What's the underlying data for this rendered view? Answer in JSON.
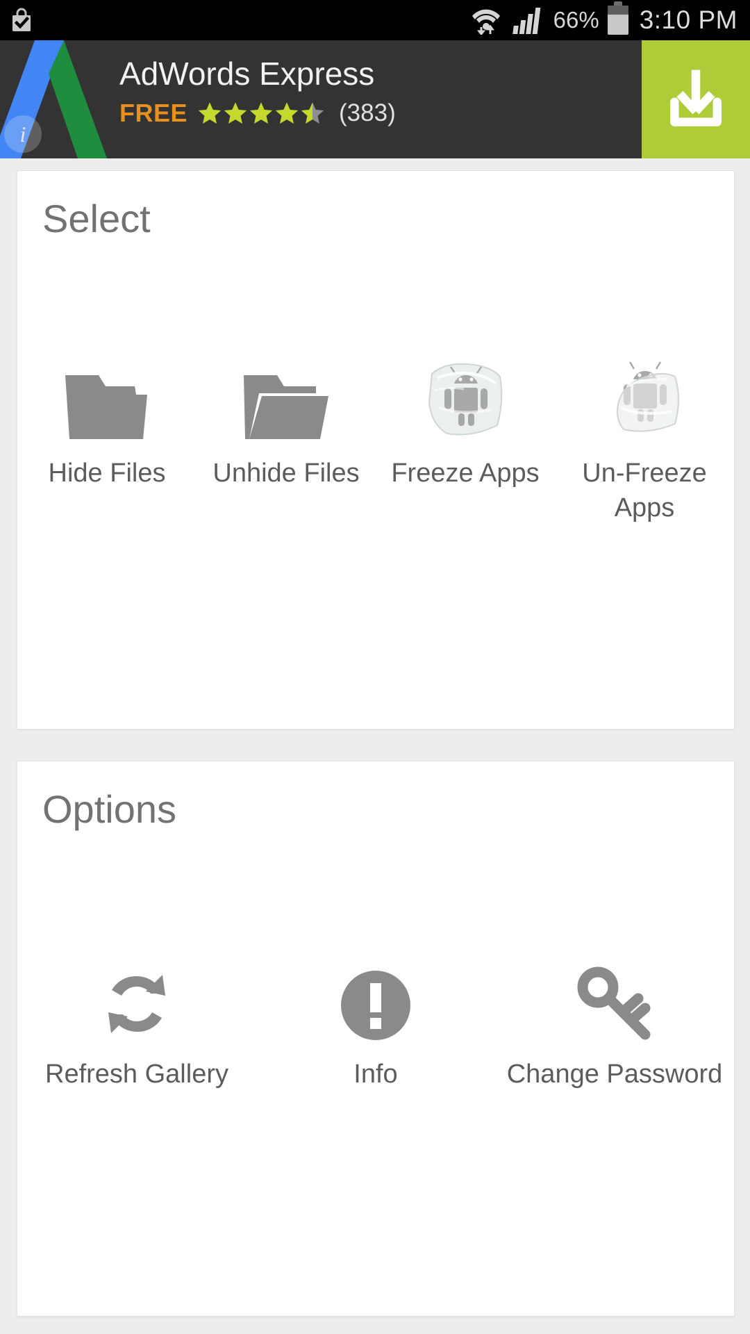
{
  "statusbar": {
    "notification_icon": "play-store-bag-check-icon",
    "wifi_icon": "wifi-signal-icon",
    "cellular_icon": "cellular-signal-icon",
    "battery_percent": "66%",
    "battery_icon": "battery-icon",
    "time": "3:10 PM"
  },
  "ad": {
    "logo_icon": "adwords-logo-icon",
    "info_badge": "i",
    "title": "AdWords Express",
    "price": "FREE",
    "rating": 4.5,
    "rating_count": "(383)",
    "download_icon": "download-icon",
    "colors": {
      "background": "#333333",
      "price": "#e8901f",
      "star_filled": "#c4d82e",
      "star_empty": "#8e8e8e",
      "download_button": "#aecb38"
    }
  },
  "cards": [
    {
      "title": "Select",
      "items": [
        {
          "label": "Hide Files",
          "icon": "folder-closed-icon"
        },
        {
          "label": "Unhide Files",
          "icon": "folder-open-icon"
        },
        {
          "label": "Freeze Apps",
          "icon": "android-frozen-ice-icon"
        },
        {
          "label": "Un-Freeze Apps",
          "icon": "android-melting-ice-icon"
        }
      ]
    },
    {
      "title": "Options",
      "items": [
        {
          "label": "Refresh Gallery",
          "icon": "refresh-icon"
        },
        {
          "label": "Info",
          "icon": "info-exclamation-icon"
        },
        {
          "label": "Change Password",
          "icon": "key-icon"
        }
      ]
    }
  ],
  "theme": {
    "page_background": "#ededed",
    "card_background": "#ffffff",
    "title_color": "#727272",
    "label_color": "#5c5c5c",
    "icon_color": "#8a8a8a"
  }
}
